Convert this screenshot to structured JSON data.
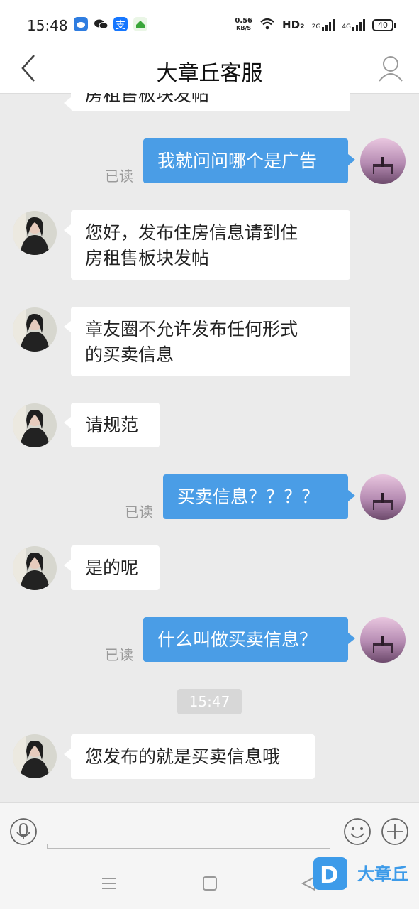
{
  "status_bar": {
    "time": "15:48",
    "net_speed": "0.56",
    "net_unit": "KB/S",
    "hd": "HD₂",
    "sig1": "2G",
    "sig2": "4G",
    "battery": "40"
  },
  "header": {
    "title": "大章丘客服"
  },
  "messages": [
    {
      "side": "in",
      "text": "房租售板块发帖"
    },
    {
      "side": "out",
      "text": "我就问问哪个是广告",
      "read": "已读"
    },
    {
      "side": "in",
      "line1": "您好，发布住房信息请到住",
      "line2": "房租售板块发帖"
    },
    {
      "side": "in",
      "line1": "章友圈不允许发布任何形式",
      "line2": "的买卖信息"
    },
    {
      "side": "in",
      "text": "请规范"
    },
    {
      "side": "out",
      "text": "买卖信息？？？？",
      "read": "已读"
    },
    {
      "side": "in",
      "text": "是的呢"
    },
    {
      "side": "out",
      "text": "什么叫做买卖信息？",
      "read": "已读"
    },
    {
      "side": "in",
      "text": "您发布的就是买卖信息哦"
    }
  ],
  "timestamp": "15:47",
  "watermark": {
    "text": "大章丘",
    "logo_letter": "D"
  }
}
